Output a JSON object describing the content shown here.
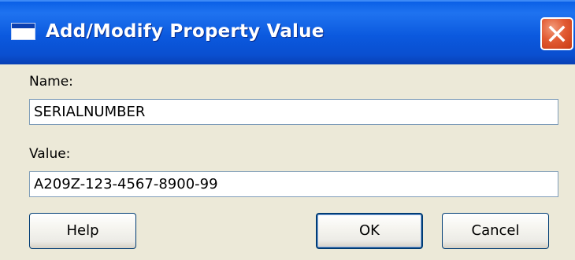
{
  "window": {
    "title": "Add/Modify Property Value",
    "title_icon": "window-icon",
    "close_icon": "close-icon"
  },
  "form": {
    "name_label": "Name:",
    "name_value": "SERIALNUMBER",
    "value_label": "Value:",
    "value_value": "A209Z-123-4567-8900-99"
  },
  "buttons": {
    "help": "Help",
    "ok": "OK",
    "cancel": "Cancel"
  },
  "colors": {
    "titlebar": "#0a5fe6",
    "dialog_background": "#ece9d8",
    "close_button": "#e25b33",
    "button_border": "#003c74"
  }
}
